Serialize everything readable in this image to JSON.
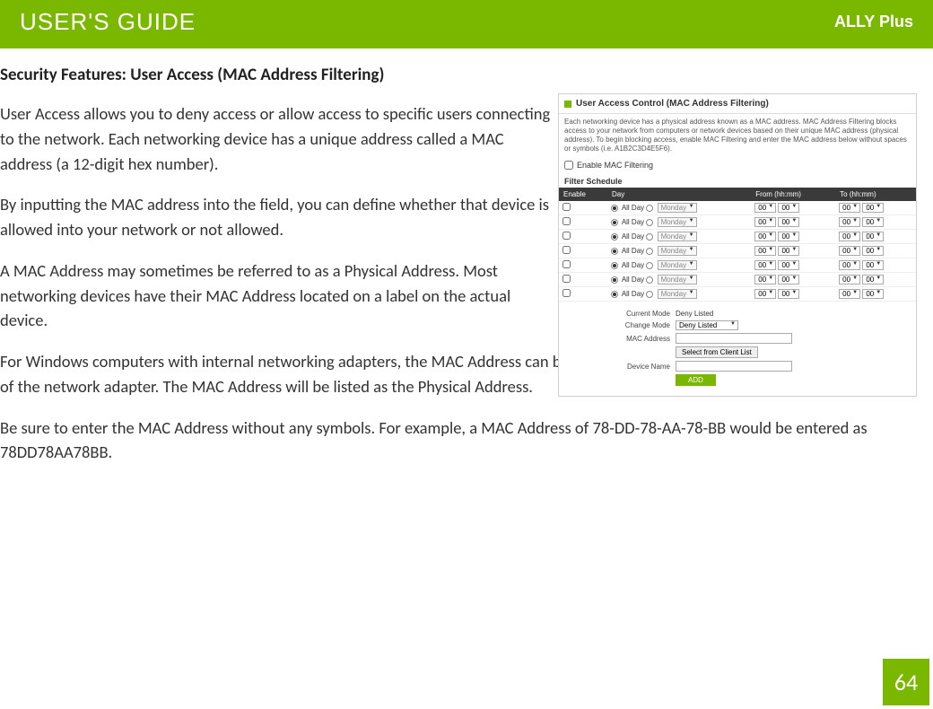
{
  "banner": {
    "left": "USER'S GUIDE",
    "right": "ALLY Plus"
  },
  "section_title": "Security Features: User Access (MAC Address Filtering)",
  "paragraphs": {
    "p1": "User Access allows you to deny access or allow access to specific users connecting to the network.  Each networking device has a unique address called a MAC address (a 12-digit hex number).",
    "p2": "By inputting the MAC address into the field, you can define whether that device is allowed into your network or not allowed.",
    "p3": "A MAC Address may sometimes be referred to as a Physical Address.  Most networking devices have their MAC Address located on a label on the actual device.",
    "p4": "For Windows computers with internal networking adapters, the MAC Address can be found by viewing the Network Connection Details of the network adapter.  The MAC Address will be listed as the Physical Address.",
    "p5": "Be sure to enter the MAC Address without any symbols.  For example, a MAC Address of 78-DD-78-AA-78-BB would be entered as 78DD78AA78BB."
  },
  "screenshot": {
    "title": "User Access Control (MAC Address Filtering)",
    "desc": "Each networking device has a physical address known as a MAC address. MAC Address Filtering blocks access to your network from computers or network devices based on their unique MAC address (physical address). To begin blocking access, enable MAC Filtering and enter the MAC address below without spaces or symbols (i.e. A1B2C3D4E5F6).",
    "enable_label": "Enable MAC Filtering",
    "schedule_label": "Filter Schedule",
    "table": {
      "headers": {
        "enable": "Enable",
        "day": "Day",
        "from": "From (hh:mm)",
        "to": "To (hh:mm)"
      },
      "row": {
        "allday": "All Day",
        "weekday": "Monday",
        "hh": "00",
        "mm": "00"
      },
      "row_count": 7
    },
    "form": {
      "current_mode_label": "Current Mode",
      "current_mode_value": "Deny Listed",
      "change_mode_label": "Change Mode",
      "change_mode_value": "Deny Listed",
      "mac_label": "MAC Address",
      "select_client": "Select from Client List",
      "device_name_label": "Device Name",
      "add_btn": "ADD"
    }
  },
  "page_number": "64"
}
